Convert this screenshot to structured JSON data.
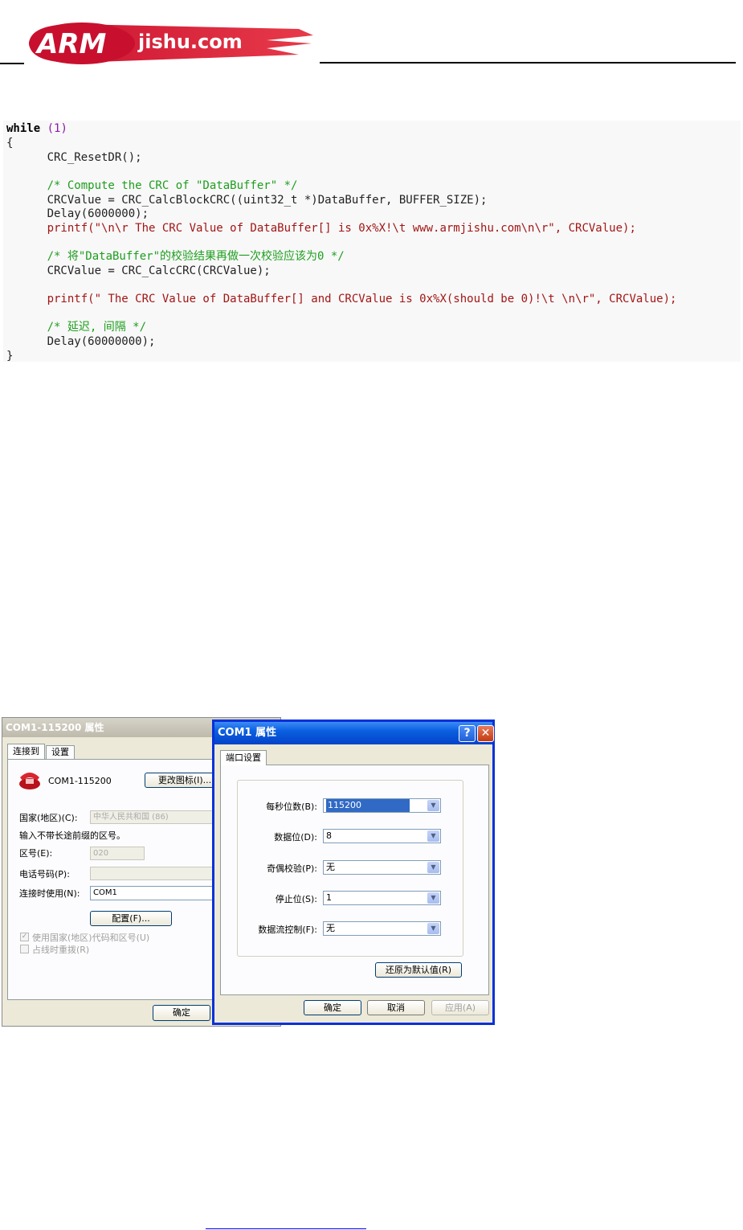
{
  "header": {
    "logo_main": "ARM",
    "logo_sub": "jishu.com"
  },
  "code": {
    "lines": [
      "while (1)",
      "{",
      "      CRC_ResetDR();",
      "",
      "      /* Compute the CRC of \"DataBuffer\" */",
      "      CRCValue = CRC_CalcBlockCRC((uint32_t *)DataBuffer, BUFFER_SIZE);",
      "      Delay(6000000);",
      "      printf(\"\\n\\r The CRC Value of DataBuffer[] is 0x%X!\\t www.armjishu.com\\n\\r\", CRCValue);",
      "",
      "      /* 将\"DataBuffer\"的校验结果再做一次校验应该为0 */",
      "      CRCValue = CRC_CalcCRC(CRCValue);",
      "",
      "      printf(\" The CRC Value of DataBuffer[] and CRCValue is 0x%X(should be 0)!\\t \\n\\r\", CRCValue);",
      "",
      "      /* 延迟, 间隔 */",
      "      Delay(60000000);",
      "}"
    ]
  },
  "dialog1": {
    "title": "COM1-115200 属性",
    "tabs": [
      "连接到",
      "设置"
    ],
    "connection_name": "COM1-115200",
    "change_icon_button": "更改图标(I)...",
    "country_label": "国家(地区)(C):",
    "country_value": "中华人民共和国 (86)",
    "hint": "输入不带长途前缀的区号。",
    "area_label": "区号(E):",
    "area_value": "020",
    "phone_label": "电话号码(P):",
    "phone_value": "",
    "connect_label": "连接时使用(N):",
    "connect_value": "COM1",
    "config_button": "配置(F)...",
    "use_code_label": "使用国家(地区)代码和区号(U)",
    "redial_label": "占线时重拨(R)",
    "ok_button": "确定"
  },
  "dialog2": {
    "title": "COM1 属性",
    "help_button": "?",
    "close_button": "✕",
    "tab": "端口设置",
    "fields": [
      {
        "label": "每秒位数(B):",
        "value": "115200"
      },
      {
        "label": "数据位(D):",
        "value": "8"
      },
      {
        "label": "奇偶校验(P):",
        "value": "无"
      },
      {
        "label": "停止位(S):",
        "value": "1"
      },
      {
        "label": "数据流控制(F):",
        "value": "无"
      }
    ],
    "restore_button": "还原为默认值(R)",
    "ok_button": "确定",
    "cancel_button": "取消",
    "apply_button": "应用(A)"
  }
}
